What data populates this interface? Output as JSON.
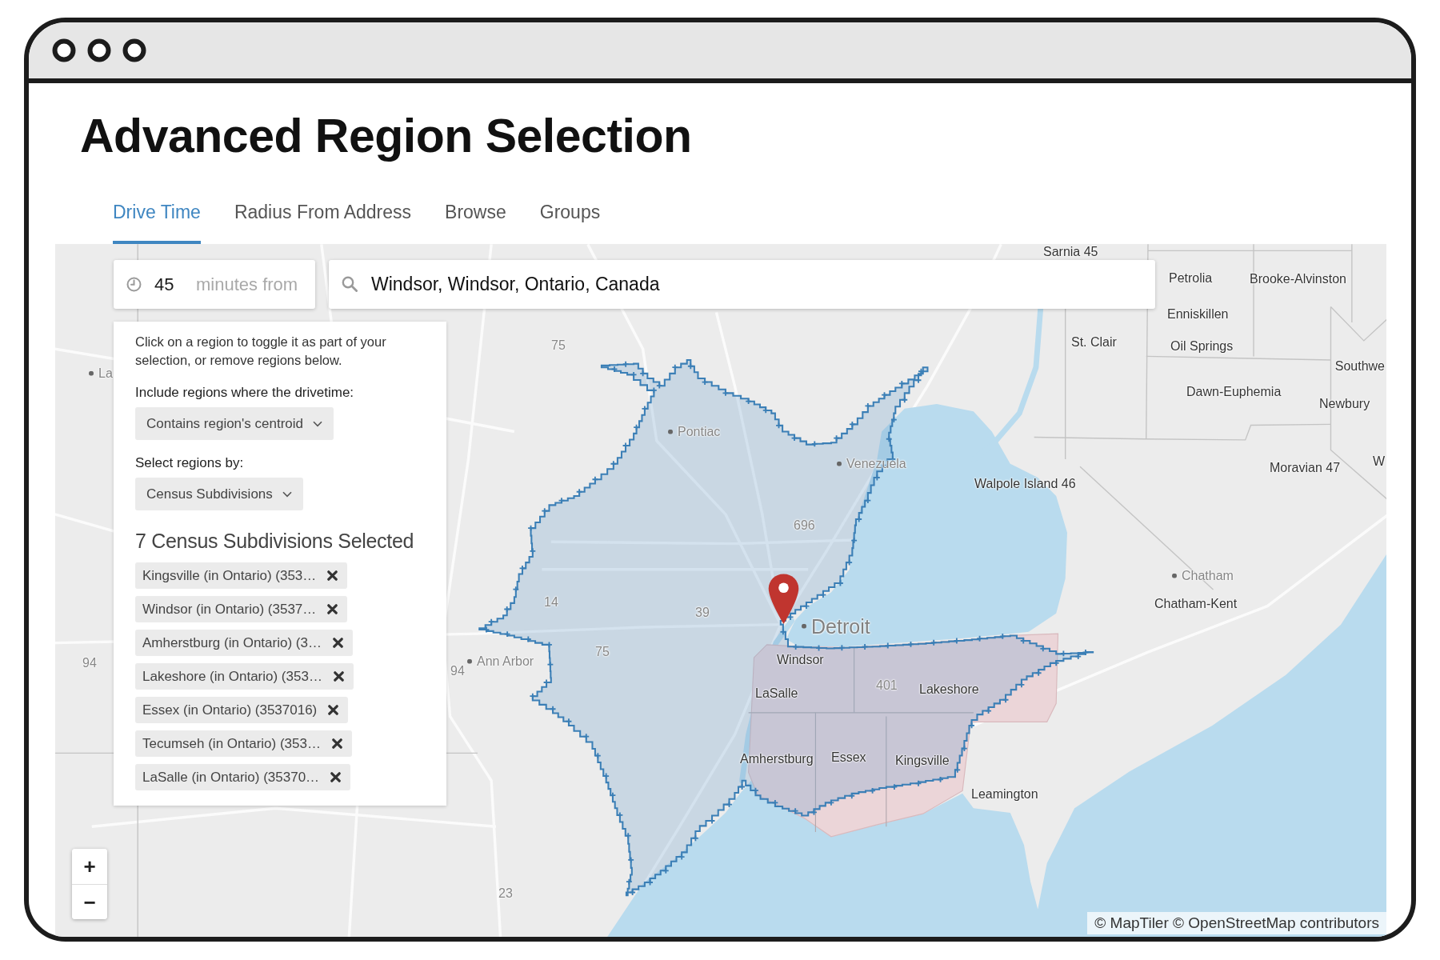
{
  "window": {
    "title": "Advanced Region Selection"
  },
  "tabs": [
    {
      "label": "Drive Time",
      "selected": true
    },
    {
      "label": "Radius From Address",
      "selected": false
    },
    {
      "label": "Browse",
      "selected": false
    },
    {
      "label": "Groups",
      "selected": false
    }
  ],
  "drive_time": {
    "minutes": "45",
    "unit_label": "minutes from",
    "address": "Windsor, Windsor, Ontario, Canada"
  },
  "panel": {
    "instructions": "Click on a region to toggle it as part of your selection, or remove regions below.",
    "drivetime_label": "Include regions where the drivetime:",
    "drivetime_option": "Contains region's centroid",
    "select_by_label": "Select regions by:",
    "select_by_option": "Census Subdivisions",
    "selected_heading": "7 Census Subdivisions Selected",
    "selected_regions": [
      "Kingsville (in Ontario) (353…",
      "Windsor (in Ontario) (3537…",
      "Amherstburg (in Ontario) (3…",
      "Lakeshore (in Ontario) (353…",
      "Essex (in Ontario) (3537016)",
      "Tecumseh (in Ontario) (353…",
      "LaSalle (in Ontario) (35370…"
    ]
  },
  "map": {
    "labels": [
      {
        "text": "Sarnia 45",
        "kind": "area"
      },
      {
        "text": "Petrolia",
        "kind": "area"
      },
      {
        "text": "Brooke-Alvinston",
        "kind": "area"
      },
      {
        "text": "Enniskillen",
        "kind": "area"
      },
      {
        "text": "75",
        "kind": "road"
      },
      {
        "text": "St. Clair",
        "kind": "area"
      },
      {
        "text": "Oil Springs",
        "kind": "area"
      },
      {
        "text": "La",
        "kind": "city"
      },
      {
        "text": "Southwe",
        "kind": "area"
      },
      {
        "text": "Dawn-Euphemia",
        "kind": "area"
      },
      {
        "text": "Newbury",
        "kind": "area"
      },
      {
        "text": "Pontiac",
        "kind": "city"
      },
      {
        "text": "Venezuela",
        "kind": "city"
      },
      {
        "text": "Moravian 47",
        "kind": "area"
      },
      {
        "text": "W",
        "kind": "area"
      },
      {
        "text": "Walpole Island 46",
        "kind": "area"
      },
      {
        "text": "696",
        "kind": "road"
      },
      {
        "text": "Chatham",
        "kind": "city"
      },
      {
        "text": "14",
        "kind": "road"
      },
      {
        "text": "39",
        "kind": "road"
      },
      {
        "text": "Chatham-Kent",
        "kind": "area"
      },
      {
        "text": "Detroit",
        "kind": "metro"
      },
      {
        "text": "94",
        "kind": "road"
      },
      {
        "text": "94",
        "kind": "road"
      },
      {
        "text": "Ann Arbor",
        "kind": "city"
      },
      {
        "text": "75",
        "kind": "road"
      },
      {
        "text": "Windsor",
        "kind": "area"
      },
      {
        "text": "LaSalle",
        "kind": "area"
      },
      {
        "text": "401",
        "kind": "road"
      },
      {
        "text": "Lakeshore",
        "kind": "area"
      },
      {
        "text": "Amherstburg",
        "kind": "area"
      },
      {
        "text": "Essex",
        "kind": "area"
      },
      {
        "text": "Kingsville",
        "kind": "area"
      },
      {
        "text": "Leamington",
        "kind": "area"
      },
      {
        "text": "23",
        "kind": "road"
      }
    ],
    "zoom_controls": [
      "+",
      "−"
    ],
    "attribution": "© MapTiler © OpenStreetMap contributors"
  }
}
